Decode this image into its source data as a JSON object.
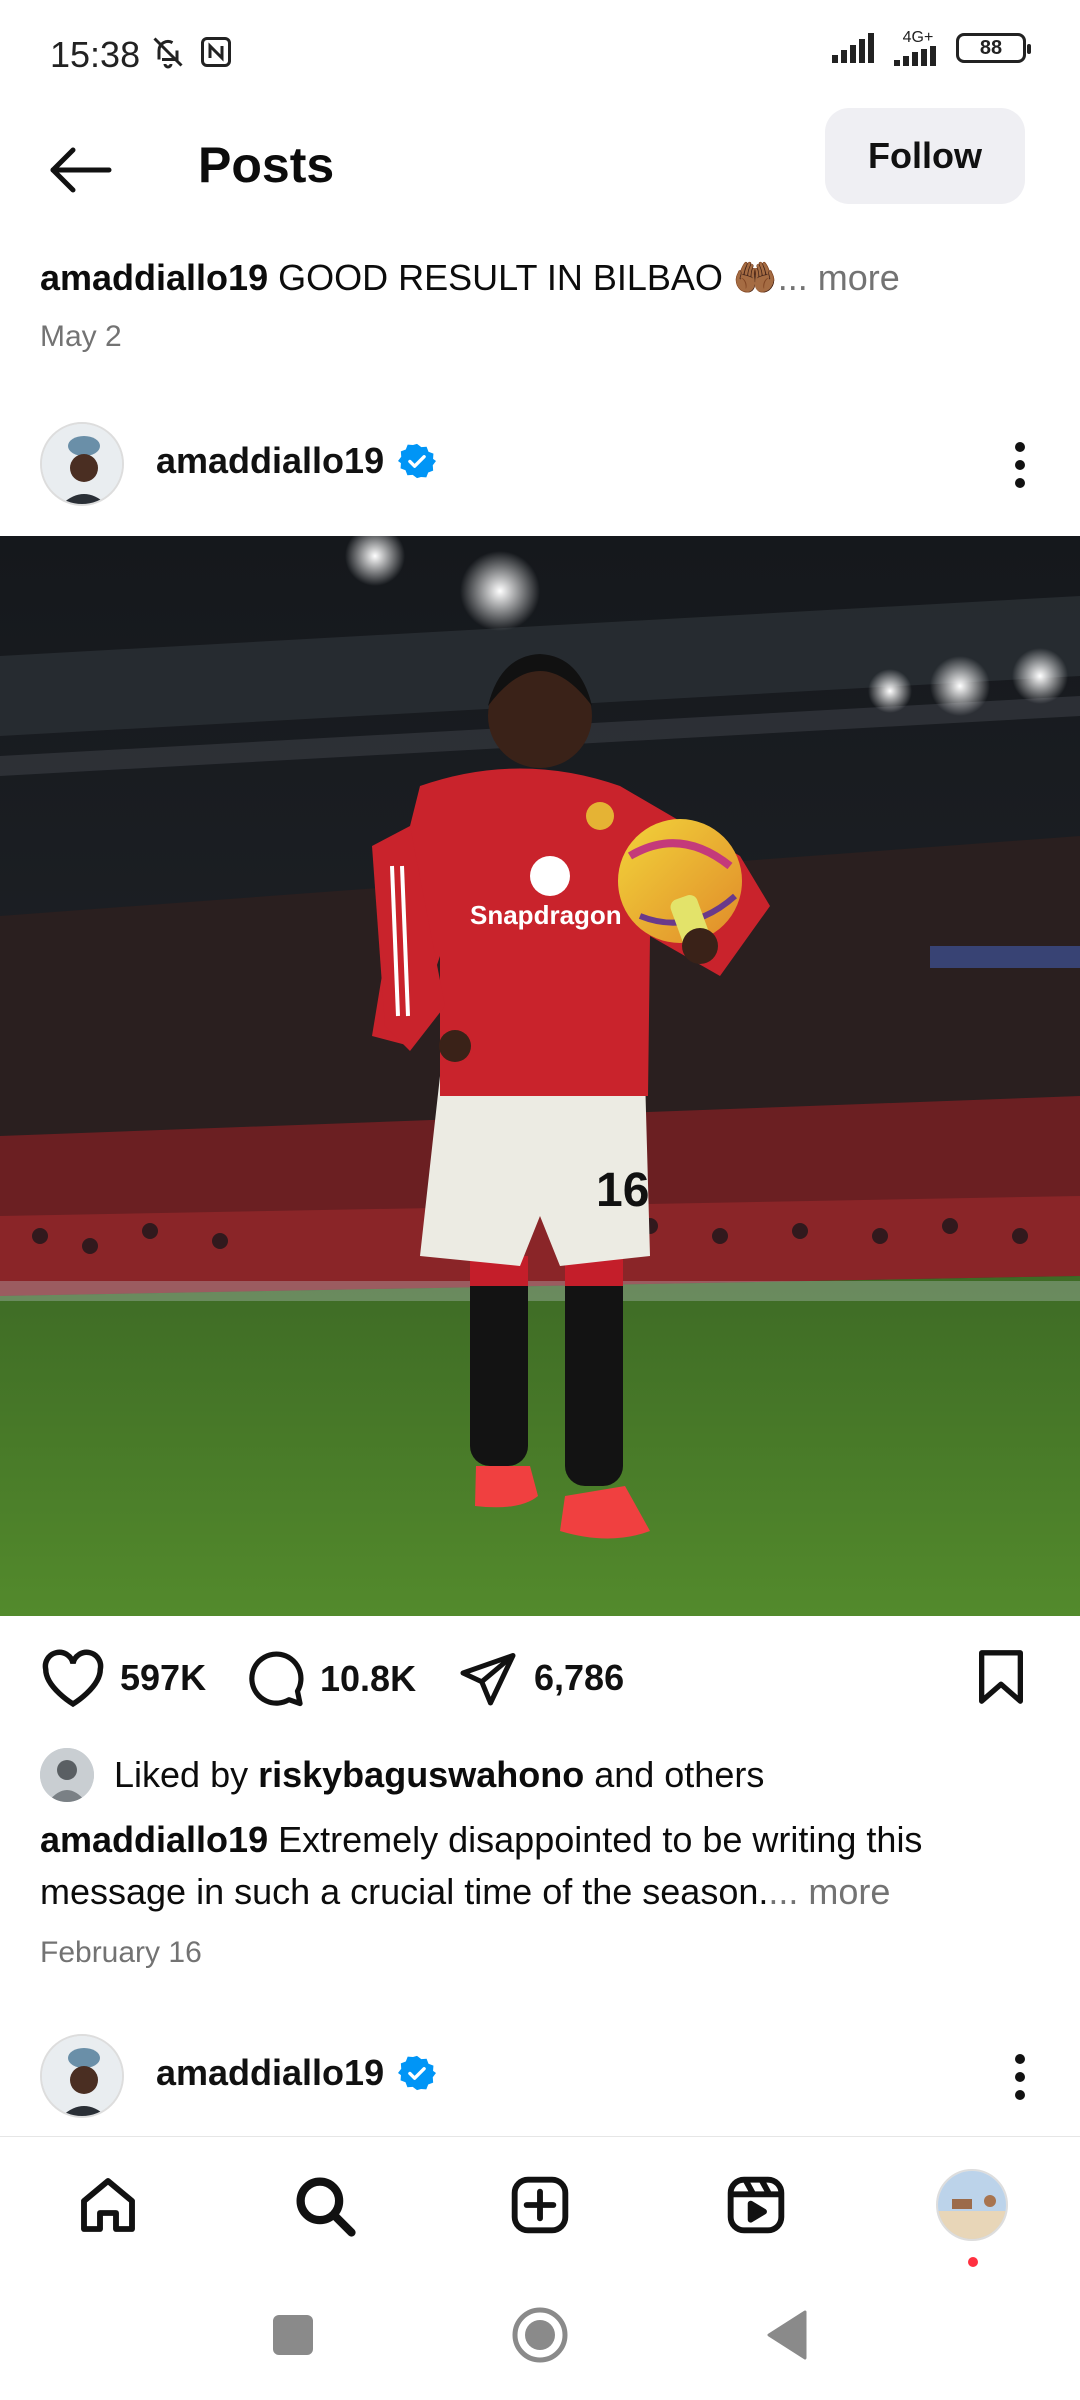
{
  "status_bar": {
    "time": "15:38",
    "network": "4G+",
    "battery": "88"
  },
  "header": {
    "title": "Posts",
    "follow_label": "Follow"
  },
  "previous_post": {
    "username": "amaddiallo19",
    "caption": "GOOD RESULT IN BILBAO 🤲🏾",
    "more": "... more",
    "date": "May 2"
  },
  "post": {
    "username": "amaddiallo19",
    "verified": true,
    "likes": "597K",
    "comments": "10.8K",
    "shares": "6,786",
    "liked_by_prefix": "Liked by",
    "liked_by_user": "riskybaguswahono",
    "liked_by_suffix": "and others",
    "caption_user": "amaddiallo19",
    "caption_text": "Extremely disappointed to be writing this message in such a crucial time of the season.",
    "caption_more": "... more",
    "date": "February 16",
    "jersey_number": "16",
    "sponsor": "Snapdragon"
  },
  "next_post": {
    "username": "amaddiallo19",
    "verified": true
  },
  "bottom_nav": {
    "items": [
      "home-icon",
      "search-icon",
      "create-icon",
      "reels-icon",
      "profile-avatar"
    ]
  },
  "colors": {
    "verified_blue": "#0095f6",
    "secondary_text": "#737373",
    "notification_red": "#ff3040",
    "follow_bg": "#efeff3"
  }
}
